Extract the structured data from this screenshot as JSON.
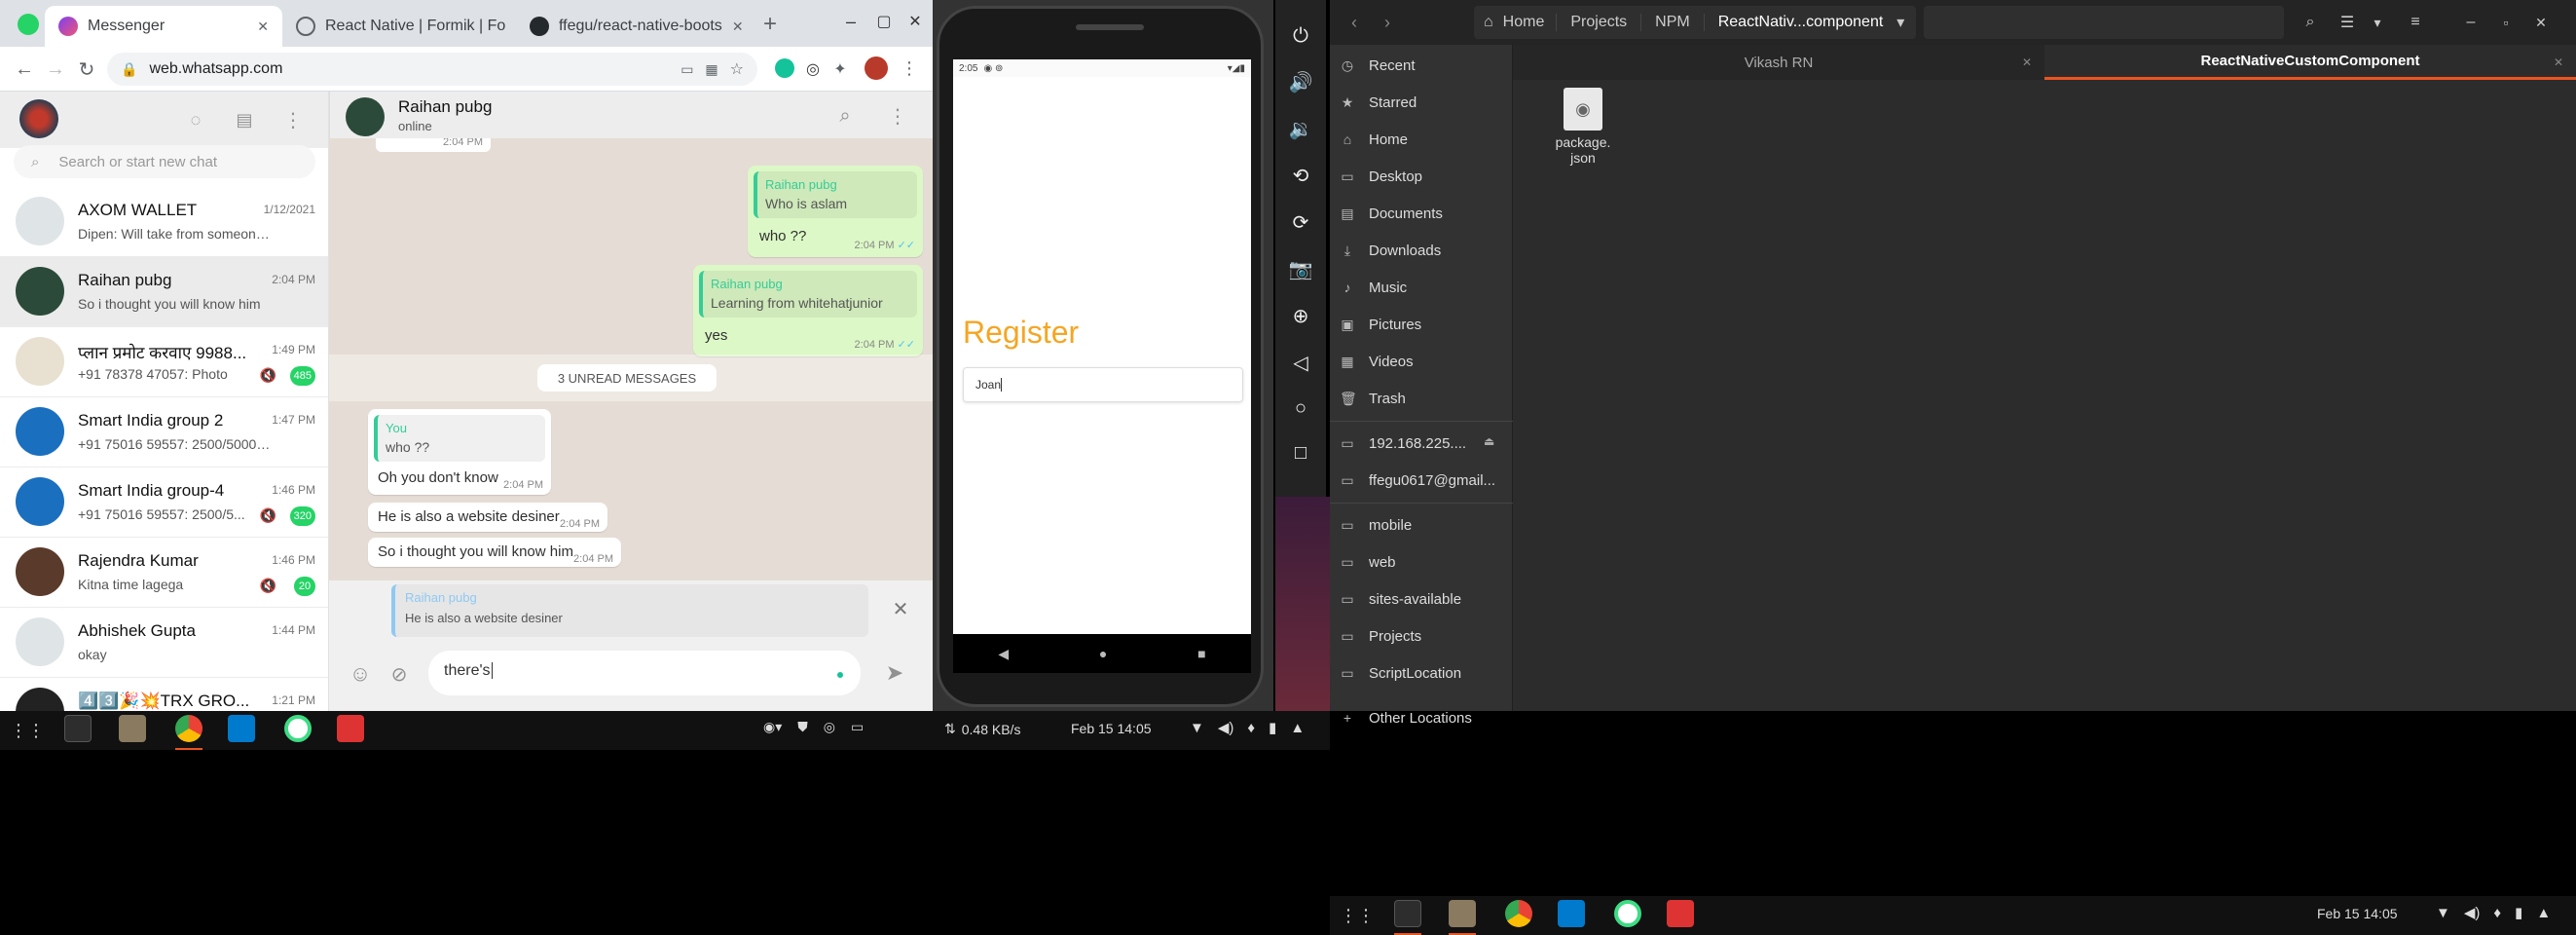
{
  "browser": {
    "tabs": [
      {
        "label": "Messenger"
      },
      {
        "label": "React Native | Formik | Fo"
      },
      {
        "label": "ffegu/react-native-boots"
      }
    ],
    "url": "web.whatsapp.com"
  },
  "whatsapp": {
    "search_placeholder": "Search or start new chat",
    "chats": [
      {
        "name": "AXOM WALLET",
        "time": "1/12/2021",
        "preview": "Dipen: Will take from someone ...",
        "badge": "",
        "selected": false,
        "avatar_color": "#dfe5e7"
      },
      {
        "name": "Raihan pubg",
        "time": "2:04 PM",
        "preview": "So i thought you will know him",
        "badge": "",
        "selected": true,
        "avatar_color": "#2c4a3a"
      },
      {
        "name": "प्लान प्रमोट करवाए 9988...",
        "time": "1:49 PM",
        "preview": "+91 78378 47057: Photo",
        "badge": "485",
        "selected": false,
        "avatar_color": "#e8e0d0"
      },
      {
        "name": "Smart India group 2",
        "time": "1:47 PM",
        "preview": "+91 75016 59557: 2500/5000/1...",
        "badge": "",
        "selected": false,
        "avatar_color": "#1a6fbf"
      },
      {
        "name": "Smart India group-4",
        "time": "1:46 PM",
        "preview": "+91 75016 59557: 2500/5...",
        "badge": "320",
        "selected": false,
        "avatar_color": "#1a6fbf"
      },
      {
        "name": "Rajendra Kumar",
        "time": "1:46 PM",
        "preview": "Kitna time lagega",
        "badge": "20",
        "selected": false,
        "avatar_color": "#5a3a2a"
      },
      {
        "name": "Abhishek Gupta",
        "time": "1:44 PM",
        "preview": "okay",
        "badge": "",
        "selected": false,
        "avatar_color": "#dfe5e7"
      },
      {
        "name": "4️⃣3️⃣🎉💥TRX GRO...",
        "time": "1:21 PM",
        "preview": "",
        "badge": "",
        "selected": false,
        "avatar_color": "#222"
      }
    ],
    "contact": {
      "name": "Raihan pubg",
      "status": "online"
    },
    "messages": {
      "top_time": "2:04 PM",
      "m1": {
        "quote_name": "Raihan pubg",
        "quote_text": "Who is aslam",
        "text": "who ??",
        "time": "2:04 PM"
      },
      "m2": {
        "quote_name": "Raihan pubg",
        "quote_text": "Learning from whitehatjunior",
        "text": "yes",
        "time": "2:04 PM"
      },
      "unread": "3 UNREAD MESSAGES",
      "m3": {
        "quote_name": "You",
        "quote_text": "who ??",
        "text": "Oh you don't know",
        "time": "2:04 PM"
      },
      "m4": {
        "text": "He is also a website desiner",
        "time": "2:04 PM"
      },
      "m5": {
        "text": "So i thought you will know him",
        "time": "2:04 PM"
      }
    },
    "reply": {
      "name": "Raihan pubg",
      "text": "He is also a website desiner"
    },
    "compose_value": "there's "
  },
  "android": {
    "status_time": "2:05",
    "title": "Register",
    "input_value": "Joan",
    "accent": "#f5a623"
  },
  "files": {
    "path": [
      "Home",
      "Projects",
      "NPM",
      "ReactNativ...component"
    ],
    "tabs": [
      "Vikash RN",
      "ReactNativeCustomComponent"
    ],
    "sidebar": [
      {
        "label": "Recent",
        "icon": "◷"
      },
      {
        "label": "Starred",
        "icon": "★"
      },
      {
        "label": "Home",
        "icon": "⌂"
      },
      {
        "label": "Desktop",
        "icon": "▭"
      },
      {
        "label": "Documents",
        "icon": "▤"
      },
      {
        "label": "Downloads",
        "icon": "⤓"
      },
      {
        "label": "Music",
        "icon": "♪"
      },
      {
        "label": "Pictures",
        "icon": "▣"
      },
      {
        "label": "Videos",
        "icon": "▦"
      },
      {
        "label": "Trash",
        "icon": "🗑"
      }
    ],
    "network": [
      {
        "label": "192.168.225....",
        "icon": "▭"
      },
      {
        "label": "ffegu0617@gmail...",
        "icon": "▭"
      }
    ],
    "bookmarks": [
      {
        "label": "mobile",
        "icon": "▭"
      },
      {
        "label": "web",
        "icon": "▭"
      },
      {
        "label": "sites-available",
        "icon": "▭"
      },
      {
        "label": "Projects",
        "icon": "▭"
      },
      {
        "label": "ScriptLocation",
        "icon": "▭"
      }
    ],
    "other": "Other Locations",
    "file": {
      "name": "package.\njson"
    }
  },
  "taskbar": {
    "net": "0.48 KB/s",
    "datetime": "Feb 15  14:05",
    "datetime2": "Feb 15  14:05"
  }
}
